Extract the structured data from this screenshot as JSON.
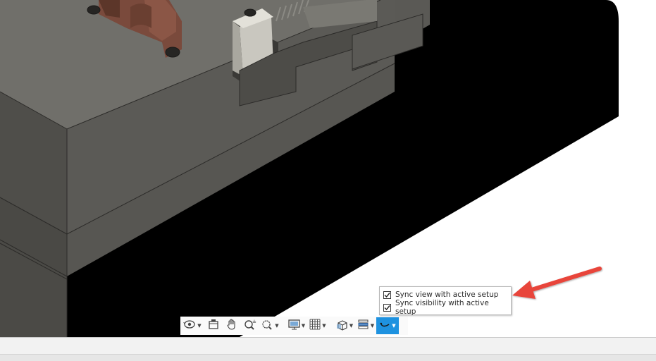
{
  "viewport": {
    "model_description_name": "cad-model-viewport"
  },
  "colors": {
    "background": "#ffffff",
    "model_top": "#6e6d68",
    "model_side": "#4e4d49",
    "model_shadow": "#000000",
    "model_copper": "#7a4a3c",
    "active_button": "#1e92e0",
    "annotation_arrow": "#e8443a"
  },
  "nav_toolbar": {
    "buttons": [
      {
        "name": "orbit-icon",
        "glyph": "⟳",
        "has_caret": true,
        "active": false
      },
      {
        "name": "look-at-icon",
        "glyph": "▭",
        "has_caret": false,
        "active": false
      },
      {
        "name": "pan-icon",
        "glyph": "✋",
        "has_caret": false,
        "active": false
      },
      {
        "name": "zoom-icon",
        "glyph": "🔍",
        "has_caret": false,
        "active": false
      },
      {
        "name": "fit-icon",
        "glyph": "⌕",
        "has_caret": true,
        "active": false
      },
      {
        "name": "display-settings-icon",
        "glyph": "🖵",
        "has_caret": true,
        "active": false
      },
      {
        "name": "grid-icon",
        "glyph": "▦",
        "has_caret": true,
        "active": false
      },
      {
        "name": "view-cube-icon",
        "glyph": "⬚",
        "has_caret": true,
        "active": false
      },
      {
        "name": "section-analysis-icon",
        "glyph": "☰",
        "has_caret": true,
        "active": false
      },
      {
        "name": "sync-setup-icon",
        "glyph": "◡",
        "has_caret": true,
        "active": true
      }
    ]
  },
  "sync_menu": {
    "items": [
      {
        "label": "Sync view with active setup",
        "checked": true
      },
      {
        "label": "Sync visibility with active setup",
        "checked": true
      }
    ]
  }
}
